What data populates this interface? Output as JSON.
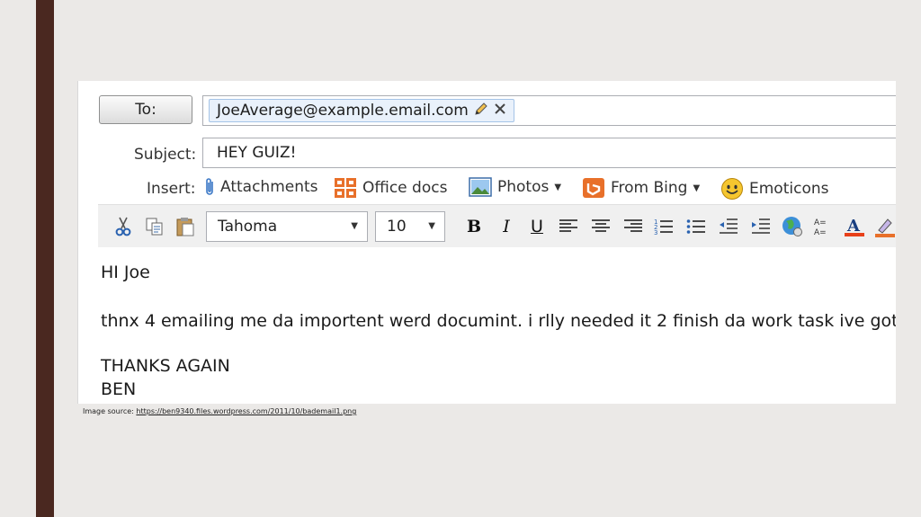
{
  "compose": {
    "to_button": "To:",
    "recipient": "JoeAverage@example.email.com",
    "subject_label": "Subject:",
    "subject_value": "HEY GUIZ!",
    "insert_label": "Insert:",
    "insert_items": [
      {
        "label": "Attachments",
        "icon": "paperclip-icon"
      },
      {
        "label": "Office docs",
        "icon": "office-docs-icon"
      },
      {
        "label": "Photos",
        "icon": "photos-icon",
        "dropdown": true
      },
      {
        "label": "From Bing",
        "icon": "bing-icon",
        "dropdown": true
      },
      {
        "label": "Emoticons",
        "icon": "emoticon-icon"
      }
    ],
    "font_name": "Tahoma",
    "font_size": "10",
    "format_bold": "B",
    "format_italic": "I",
    "format_underline": "U",
    "body_lines": [
      "HI Joe",
      "thnx 4 emailing me da importent werd documint. i rlly needed it 2 finish da work task ive got",
      "THANKS AGAIN",
      "BEN"
    ]
  },
  "caption": {
    "prefix": "Image source: ",
    "link": "https://ben9340.files.wordpress.com/2011/10/bademail1.png"
  },
  "colors": {
    "side_bar": "#4a2820",
    "background": "#ebe9e7",
    "accent_orange": "#e8702a",
    "accent_blue": "#3b78c6"
  }
}
